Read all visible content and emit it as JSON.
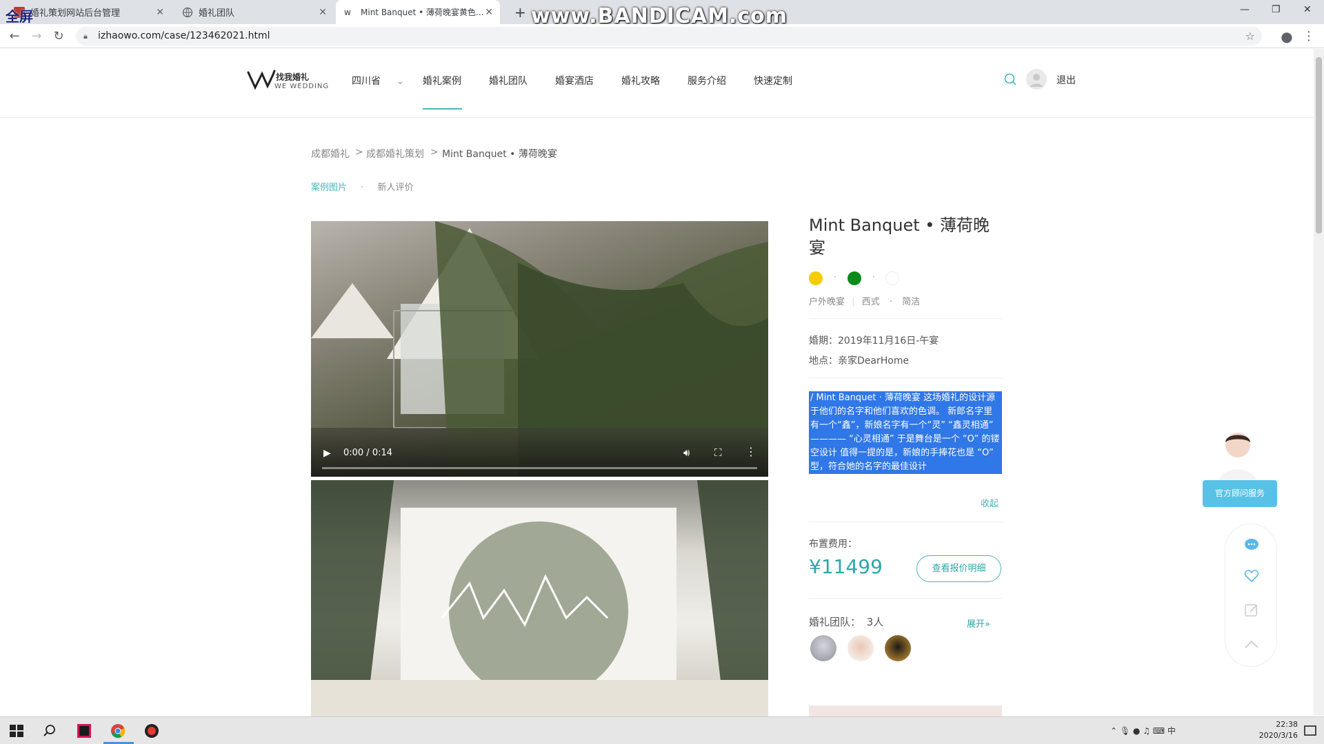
{
  "browser": {
    "tabs": [
      {
        "title": "婚礼策划网站后台管理"
      },
      {
        "title": "婚礼团队"
      },
      {
        "title": "Mint Banquet • 薄荷晚宴黄色..."
      }
    ],
    "new_tab": "+",
    "url": "izhaowo.com/case/123462021.html",
    "overlay_fullscreen": "全屏",
    "overlay_watermark": "www.BANDICAM.com"
  },
  "site": {
    "logo_cn": "找我婚礼",
    "logo_en": "WE WEDDING",
    "region": "四川省",
    "nav": [
      "婚礼案例",
      "婚礼团队",
      "婚宴酒店",
      "婚礼攻略",
      "服务介绍",
      "快速定制"
    ],
    "active_nav": "婚礼案例",
    "logout": "退出"
  },
  "breadcrumb": [
    "成都婚礼",
    "成都婚礼策划",
    "Mint Banquet • 薄荷晚宴"
  ],
  "subtabs": [
    "案例图片",
    "新人评价"
  ],
  "video": {
    "time": "0:00 / 0:14"
  },
  "case": {
    "title": "Mint Banquet • 薄荷晚宴",
    "colors": [
      "#f5cc00",
      "#0c8a1a",
      "#ffffff"
    ],
    "tags": [
      "户外晚宴",
      "西式",
      "简洁"
    ],
    "date_label": "婚期：",
    "date": "2019年11月16日-午宴",
    "venue_label": "地点：",
    "venue": "亲家DearHome",
    "description": "/ Mint Banquet · 薄荷晚宴 这场婚礼的设计源于他们的名字和他们喜欢的色调。 新郎名字里有一个“鑫”，新娘名字有一个“灵” “鑫灵相通” ———— “心灵相通” 于是舞台是一个 “O” 的镂空设计 值得一提的是，新娘的手捧花也是 “O” 型，符合她的名字的最佳设计",
    "collapse": "收起",
    "fee_label": "布置费用：",
    "price": "¥11499",
    "quote_button": "查看报价明细",
    "team_label": "婚礼团队：",
    "team_count": "3人",
    "expand": "展开»"
  },
  "side": {
    "consult": "官方顾问服务"
  },
  "taskbar": {
    "time": "22:38",
    "date": "2020/3/16"
  }
}
